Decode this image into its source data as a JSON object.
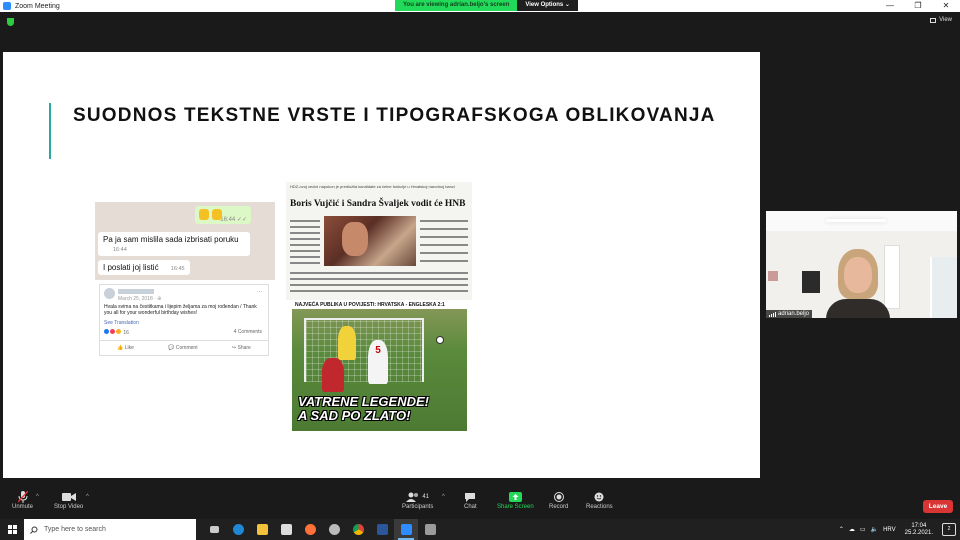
{
  "window": {
    "title": "Zoom Meeting",
    "controls": [
      "—",
      "❐",
      "✕"
    ]
  },
  "share_banner": {
    "viewing_text": "You are viewing adrian.beljo's screen",
    "view_options_label": "View Options ⌄"
  },
  "meeting": {
    "view_label": "View"
  },
  "slide": {
    "heading": "SUODNOS TEKSTNE VRSTE I TIPOGRAFSKOGA OBLIKOVANJA",
    "whatsapp": {
      "emoji_time": "16:44 ✓✓",
      "messages": [
        {
          "text": "Pa ja sam mislila sada izbrisati poruku",
          "time": "16:44"
        },
        {
          "text": "I poslati joj listić",
          "time": "16:45"
        }
      ]
    },
    "facebook": {
      "date": "March 25, 2018 · ⊕",
      "message": "Hvala svima na čestitkama i lijepim željama za moj rođendan / Thank you all for your wonderful birthday wishes!",
      "see_translation": "See Translation",
      "reactions_count": "16",
      "comments_count": "4 Comments",
      "actions": [
        "Like",
        "Comment",
        "Share"
      ],
      "more": "···"
    },
    "newspaper": {
      "kicker": "HDZ-ovoj većini napokon je predložila kandidate za čelne funkcije u Hrvatskoj narodnoj banci",
      "headline": "Boris Vujčić i Sandra Švaljek vodit će HNB"
    },
    "football": {
      "caption": "NAJVEĆA PUBLIKA U POVIJESTI: HRVATSKA - ENGLESKA 2:1",
      "slogan_line1": "VATRENE LEGENDE!",
      "slogan_line2": "A SAD PO ZLATO!",
      "player_number": "5"
    }
  },
  "participant": {
    "name": "adrian.beljo"
  },
  "toolbar": {
    "unmute": "Unmute",
    "stop_video": "Stop Video",
    "participants": "Participants",
    "participants_count": "41",
    "chat": "Chat",
    "share_screen": "Share Screen",
    "record": "Record",
    "reactions": "Reactions",
    "leave": "Leave",
    "caret": "^"
  },
  "taskbar": {
    "search_placeholder": "Type here to search",
    "apps": [
      {
        "name": "task-view",
        "color": "#cccccc"
      },
      {
        "name": "edge",
        "color": "#1e88d4"
      },
      {
        "name": "file-explorer",
        "color": "#f3c13a"
      },
      {
        "name": "store",
        "color": "#dddddd"
      },
      {
        "name": "firefox",
        "color": "#ff7139"
      },
      {
        "name": "chrome-alt",
        "color": "#bbbbbb"
      },
      {
        "name": "chrome",
        "color": "#4caf50"
      },
      {
        "name": "word",
        "color": "#2b579a"
      },
      {
        "name": "zoom",
        "color": "#2d8cff"
      },
      {
        "name": "photos",
        "color": "#9b9b9b"
      }
    ],
    "language": "HRV",
    "time": "17:04",
    "date": "25.2.2021.",
    "notifications": "2"
  }
}
